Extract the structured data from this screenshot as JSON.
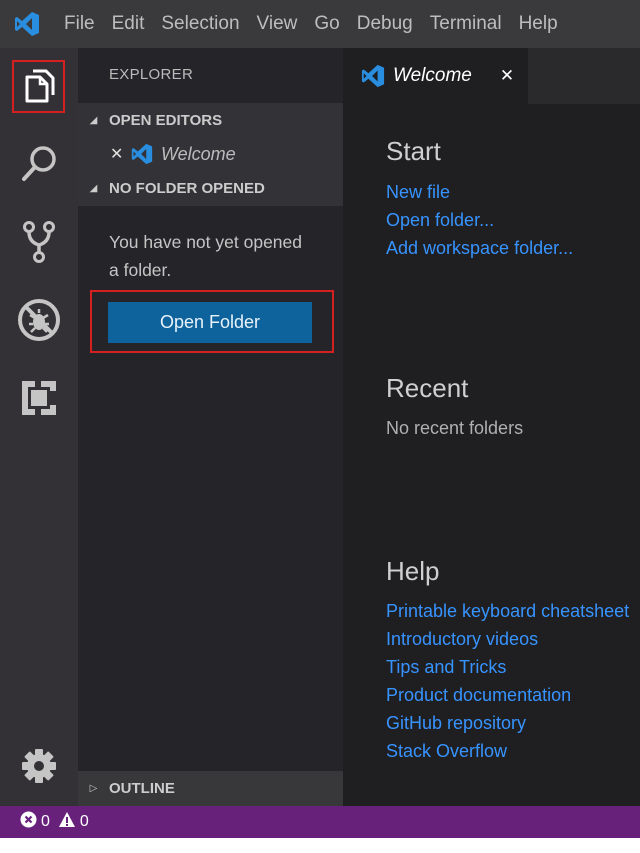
{
  "app": {
    "name": "Visual Studio Code",
    "brand_color": "#2a8ee0",
    "menu": [
      "File",
      "Edit",
      "Selection",
      "View",
      "Go",
      "Debug",
      "Terminal",
      "Help"
    ]
  },
  "activity_bar": {
    "items": [
      {
        "name": "explorer",
        "icon": "files-icon",
        "active": true,
        "highlighted": true
      },
      {
        "name": "search",
        "icon": "search-icon"
      },
      {
        "name": "source-control",
        "icon": "source-control-icon"
      },
      {
        "name": "debug",
        "icon": "debug-icon"
      },
      {
        "name": "extensions",
        "icon": "extensions-icon"
      }
    ],
    "bottom": {
      "name": "manage",
      "icon": "gear-icon"
    }
  },
  "sidebar": {
    "title": "EXPLORER",
    "open_editors": {
      "header": "OPEN EDITORS",
      "items": [
        {
          "name": "Welcome",
          "icon": "vscode-icon"
        }
      ]
    },
    "no_folder": {
      "header": "NO FOLDER OPENED",
      "message": "You have not yet opened a folder.",
      "button_label": "Open Folder",
      "button_color": "#0e639c",
      "button_highlighted": true
    },
    "outline": {
      "header": "OUTLINE"
    }
  },
  "editor": {
    "tabs": [
      {
        "label": "Welcome",
        "active": true
      }
    ],
    "welcome": {
      "start": {
        "heading": "Start",
        "links": [
          "New file",
          "Open folder...",
          "Add workspace folder..."
        ]
      },
      "recent": {
        "heading": "Recent",
        "empty_text": "No recent folders"
      },
      "help": {
        "heading": "Help",
        "links": [
          "Printable keyboard cheatsheet",
          "Introductory videos",
          "Tips and Tricks",
          "Product documentation",
          "GitHub repository",
          "Stack Overflow"
        ]
      },
      "link_color": "#3794ff"
    }
  },
  "status_bar": {
    "color": "#68217a",
    "errors": "0",
    "warnings": "0"
  }
}
